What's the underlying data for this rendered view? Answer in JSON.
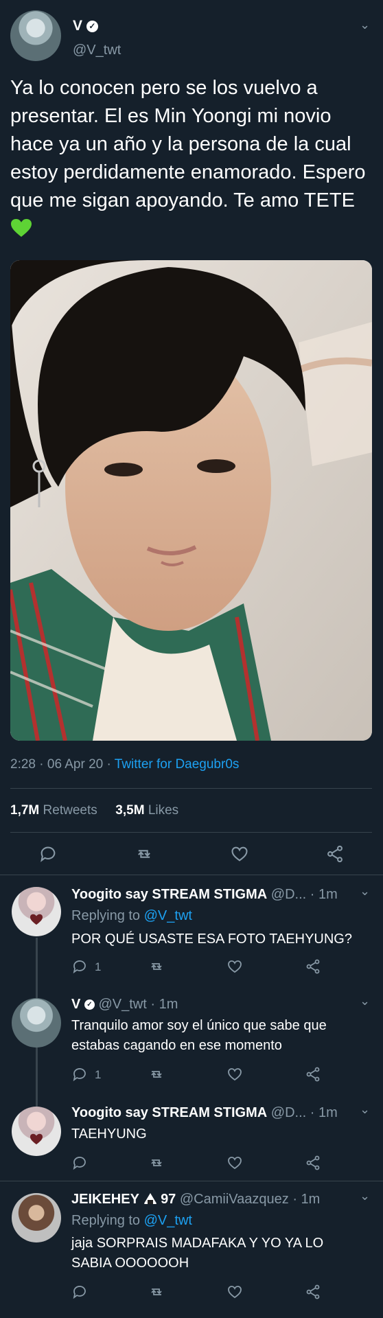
{
  "main_tweet": {
    "author_name": "V",
    "author_handle": "@V_twt",
    "text": "Ya lo conocen pero se los vuelvo a presentar. El es Min Yoongi mi novio hace ya un año y la persona de la cual estoy perdidamente enamorado. Espero que me sigan apoyando. Te amo TETE",
    "emoji": "green-heart",
    "time": "2:28",
    "date": "06 Apr 20",
    "source": "Twitter for Daegubr0s",
    "retweets_count": "1,7M",
    "retweets_label": "Retweets",
    "likes_count": "3,5M",
    "likes_label": "Likes"
  },
  "replies": [
    {
      "name": "Yoogito say STREAM STIGMA",
      "handle_time": "@D... · 1m",
      "replying_to_label": "Replying to",
      "replying_to_handle": "@V_twt",
      "text": "POR QUÉ USASTE ESA FOTO TAEHYUNG?",
      "reply_count": "1"
    },
    {
      "name": "V",
      "handle_time": "@V_twt · 1m",
      "text1": "Tranquilo amor soy el único que sabe que",
      "text2": "estabas cagando en ese momento",
      "reply_count": "1"
    },
    {
      "name": "Yoogito say STREAM STIGMA",
      "handle_time": "@D... · 1m",
      "text": "TAEHYUNG"
    },
    {
      "name": "JEIKEHEY",
      "name_suffix": "97",
      "emoji": "onigiri",
      "handle_time": "@CamiiVaazquez · 1m",
      "replying_to_label": "Replying to",
      "replying_to_handle": "@V_twt",
      "text1": "jaja SORPRAIS MADAFAKA Y YO YA LO",
      "text2": "SABIA OOOOOOH"
    }
  ],
  "colors": {
    "background": "#15202b",
    "muted": "#8899a6",
    "link": "#1da1f2",
    "divider": "#38444d"
  }
}
